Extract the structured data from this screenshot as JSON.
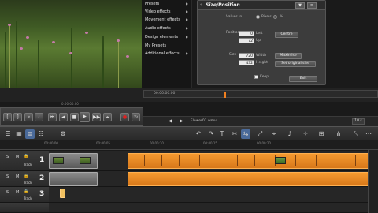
{
  "presets_menu": {
    "items": [
      {
        "label": "Presets",
        "has_arrow": true
      },
      {
        "label": "Video effects",
        "has_arrow": true
      },
      {
        "label": "Movement effects",
        "has_arrow": true
      },
      {
        "label": "Audio effects",
        "has_arrow": true
      },
      {
        "label": "Design elements",
        "has_arrow": true
      },
      {
        "label": "My Presets",
        "has_arrow": false
      },
      {
        "label": "Additional effects",
        "has_arrow": true
      }
    ]
  },
  "size_panel": {
    "title": "Size/Position",
    "values_in": "Values in",
    "unit": "Pixels",
    "position_label": "Position",
    "left_value": "0",
    "left_label": "Left",
    "top_value": "72",
    "top_label": "Up",
    "centre_label": "Centre",
    "size_label": "Size",
    "width_value": "720",
    "width_label": "Width",
    "height_value": "432",
    "height_label": "Height",
    "maximise_label": "Maximise",
    "original_size_label": "Set original size",
    "keep_label": "Keep",
    "exit_label": "Exit"
  },
  "transport": {
    "timecode": "0:00:00.00",
    "scrubber_time": "00:00:00.00",
    "zoom": "10 s"
  },
  "navbar": {
    "project_name": "Flower01.wmv"
  },
  "ruler": {
    "labels": [
      "00:00:00",
      "00:00:05",
      "00:00:10",
      "00:00:15",
      "00:00:20"
    ]
  },
  "tracks": [
    {
      "number": "1",
      "solo": "S",
      "mute": "M",
      "lock": "lock",
      "kind": "Track"
    },
    {
      "number": "2",
      "solo": "S",
      "mute": "M",
      "lock": "lock",
      "kind": "Track"
    },
    {
      "number": "3",
      "solo": "S",
      "mute": "M",
      "lock": "lock",
      "kind": "Track"
    }
  ],
  "colors": {
    "accent": "#f08020",
    "clip_orange": "#e88a22",
    "record": "#e02020"
  }
}
